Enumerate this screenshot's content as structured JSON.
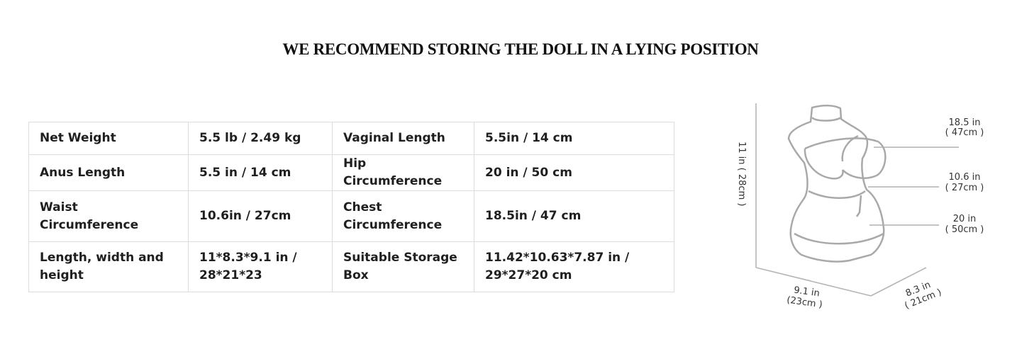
{
  "headline": "WE RECOMMEND STORING THE DOLL IN A LYING POSITION",
  "specs": {
    "rows": [
      [
        {
          "label": "Net Weight",
          "value": "5.5 lb / 2.49 kg"
        },
        {
          "label": "Vaginal Length",
          "value": "5.5in / 14 cm"
        }
      ],
      [
        {
          "label": "Anus Length",
          "value": "5.5 in / 14 cm"
        },
        {
          "label": "Hip Circumference",
          "value": "20 in / 50 cm"
        }
      ],
      [
        {
          "label": "Waist Circumference",
          "value": "10.6in / 27cm"
        },
        {
          "label": "Chest Circumference",
          "value": "18.5in / 47 cm"
        }
      ],
      [
        {
          "label": "Length, width and height",
          "value": "11*8.3*9.1 in / 28*21*23"
        },
        {
          "label": "Suitable Storage Box",
          "value": "11.42*10.63*7.87 in / 29*27*20 cm"
        }
      ]
    ]
  },
  "diagram": {
    "chest_line1": "18.5 in",
    "chest_line2": "( 47cm )",
    "waist_line1": "10.6 in",
    "waist_line2": "( 27cm )",
    "hip_line1": "20 in",
    "hip_line2": "( 50cm )",
    "height": "11 in ( 28cm )",
    "depth_line1": "9.1 in",
    "depth_line2": "(23cm )",
    "width_line1": "8.3 in",
    "width_line2": "( 21cm )",
    "stroke_color": "#a9a9a9"
  }
}
